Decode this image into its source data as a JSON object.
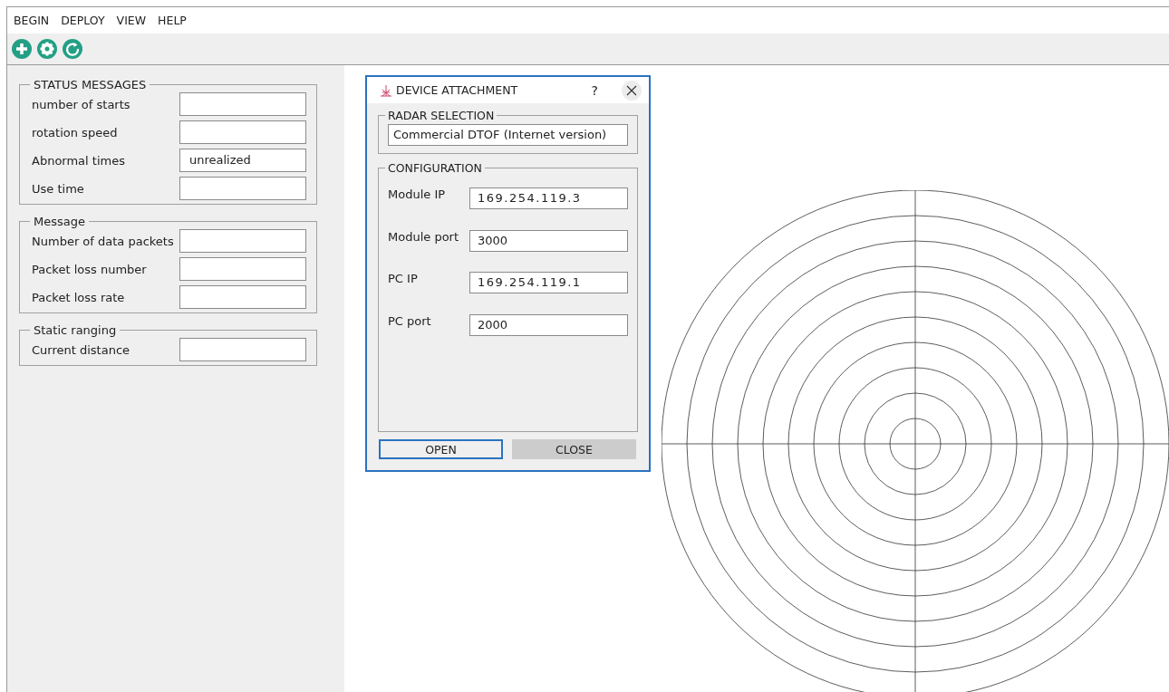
{
  "menu": [
    "BEGIN",
    "DEPLOY",
    "VIEW",
    "HELP"
  ],
  "toolbar": [
    {
      "kind": "add"
    },
    {
      "kind": "settings"
    },
    {
      "kind": "refresh"
    }
  ],
  "groups": [
    {
      "title": "STATUS MESSAGES",
      "fields": [
        {
          "label": "number of starts"
        },
        {
          "label": "rotation speed"
        },
        {
          "label": "Abnormal times",
          "value": "unrealized"
        },
        {
          "label": "Use time"
        }
      ]
    },
    {
      "title": "Message",
      "fields": [
        {
          "label": "Number of data packets"
        },
        {
          "label": "Packet loss number"
        },
        {
          "label": "Packet loss rate"
        }
      ]
    },
    {
      "title": "Static ranging",
      "fields": [
        {
          "label": "Current distance"
        }
      ]
    }
  ],
  "dialog": {
    "title": "DEVICE ATTACHMENT",
    "help": "?",
    "radar_selection": {
      "title": "RADAR SELECTION",
      "value": "Commercial DTOF (Internet version)"
    },
    "configuration": {
      "title": "CONFIGURATION",
      "fields": [
        {
          "label": "Module IP",
          "value": "169.254.119.3",
          "kind": "address"
        },
        {
          "label": "Module port",
          "value": "3000",
          "kind": "port"
        },
        {
          "label": "PC IP",
          "value": "169.254.119.1",
          "kind": "address"
        },
        {
          "label": "PC port",
          "value": "2000",
          "kind": "port"
        }
      ]
    },
    "buttons": [
      {
        "label": "OPEN",
        "selected": true
      },
      {
        "label": "CLOSE",
        "selected": false
      }
    ]
  }
}
